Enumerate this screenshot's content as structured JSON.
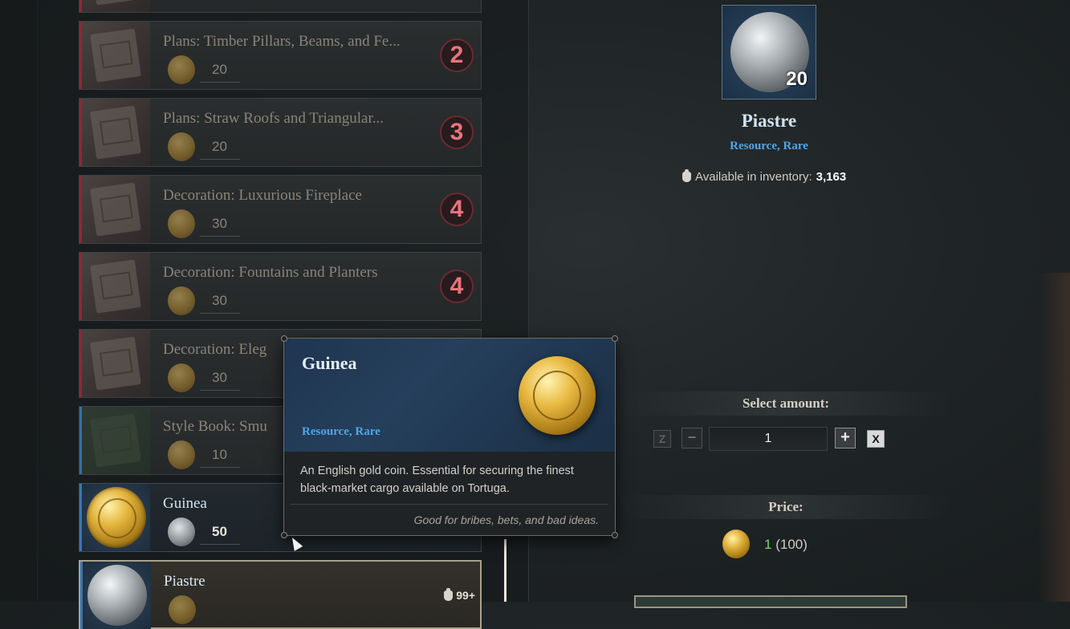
{
  "list": {
    "items": [
      {
        "title": "Plans: Timber Pillars, Beams, and Fe...",
        "price": "20",
        "badge": "2"
      },
      {
        "title": "Plans: Straw Roofs and Triangular...",
        "price": "20",
        "badge": "3"
      },
      {
        "title": "Decoration: Luxurious Fireplace",
        "price": "30",
        "badge": "4"
      },
      {
        "title": "Decoration: Fountains and Planters",
        "price": "30",
        "badge": "4"
      },
      {
        "title": "Decoration: Eleg",
        "price": "30"
      },
      {
        "title": "Style Book: Smu",
        "price": "10"
      },
      {
        "title": "Guinea",
        "price": "50"
      },
      {
        "title": "Piastre",
        "stock": "99+"
      }
    ]
  },
  "tooltip": {
    "title": "Guinea",
    "subtitle": "Resource, Rare",
    "description": "An English gold coin. Essential for securing the finest black-market cargo available on Tortuga.",
    "flavor": "Good for bribes, bets, and bad ideas."
  },
  "detail": {
    "quantity": "20",
    "name": "Piastre",
    "subtitle": "Resource, Rare",
    "inventory_label": "Available in inventory:",
    "inventory_value": "3,163"
  },
  "amount": {
    "label": "Select amount:",
    "key_z": "Z",
    "key_x": "X",
    "value": "1"
  },
  "price": {
    "label": "Price:",
    "value": "1",
    "total": "(100)"
  },
  "colors": {
    "accent_blue": "#4fa6e8",
    "badge_red": "#e8737d",
    "price_green": "#7fd36f"
  }
}
